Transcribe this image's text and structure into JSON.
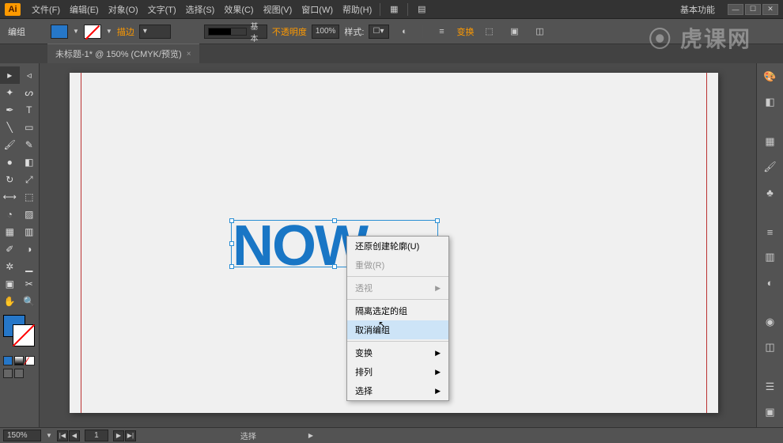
{
  "app": {
    "icon_label": "Ai"
  },
  "menubar": {
    "items": [
      "文件(F)",
      "编辑(E)",
      "对象(O)",
      "文字(T)",
      "选择(S)",
      "效果(C)",
      "视图(V)",
      "窗口(W)",
      "帮助(H)"
    ],
    "workspace": "基本功能"
  },
  "controlbar": {
    "label": "编组",
    "stroke_label": "描边",
    "stroke_value": "",
    "profile_label": "基本",
    "opacity_label": "不透明度",
    "opacity_value": "100%",
    "style_label": "样式:",
    "transform_label": "变换"
  },
  "document": {
    "tab_title": "未标题-1* @ 150% (CMYK/预览)"
  },
  "canvas": {
    "artwork_text": "NOW"
  },
  "context_menu": {
    "items": [
      {
        "label": "还原创建轮廓(U)",
        "disabled": false,
        "submenu": false
      },
      {
        "label": "重做(R)",
        "disabled": true,
        "submenu": false
      },
      {
        "sep": true
      },
      {
        "label": "透视",
        "disabled": true,
        "submenu": true
      },
      {
        "sep": true
      },
      {
        "label": "隔离选定的组",
        "disabled": false,
        "submenu": false
      },
      {
        "label": "取消编组",
        "disabled": false,
        "submenu": false,
        "hover": true
      },
      {
        "sep": true
      },
      {
        "label": "变换",
        "disabled": false,
        "submenu": true
      },
      {
        "label": "排列",
        "disabled": false,
        "submenu": true
      },
      {
        "label": "选择",
        "disabled": false,
        "submenu": true
      }
    ]
  },
  "statusbar": {
    "zoom": "150%",
    "page": "1",
    "tool_label": "选择"
  },
  "watermark": "虎课网",
  "colors": {
    "fill": "#2677c8",
    "accent": "#ff9a00"
  }
}
